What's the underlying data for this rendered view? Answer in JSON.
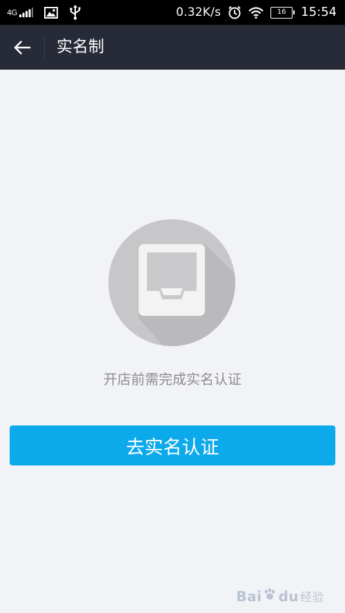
{
  "status_bar": {
    "network_type": "4G",
    "net_speed": "0.32K/s",
    "battery_level": "16",
    "time": "15:54",
    "icons": [
      "signal-icon",
      "image-icon",
      "usb-icon",
      "alarm-icon",
      "wifi-icon",
      "battery-icon"
    ]
  },
  "nav": {
    "back_icon": "back-arrow-icon",
    "title": "实名制"
  },
  "empty_state": {
    "illustration_icon": "empty-tray-icon",
    "message": "开店前需完成实名认证"
  },
  "actions": {
    "verify_button_label": "去实名认证"
  },
  "watermark": {
    "brand": "Bai",
    "brand_suffix": "du",
    "sub": "经验"
  },
  "colors": {
    "status_bar_bg": "#000000",
    "nav_bg": "#262b37",
    "page_bg": "#f2f3f7",
    "accent_button": "#0daaeb",
    "circle_gray": "#c7c6c8",
    "message_text": "#8d8d8d"
  }
}
